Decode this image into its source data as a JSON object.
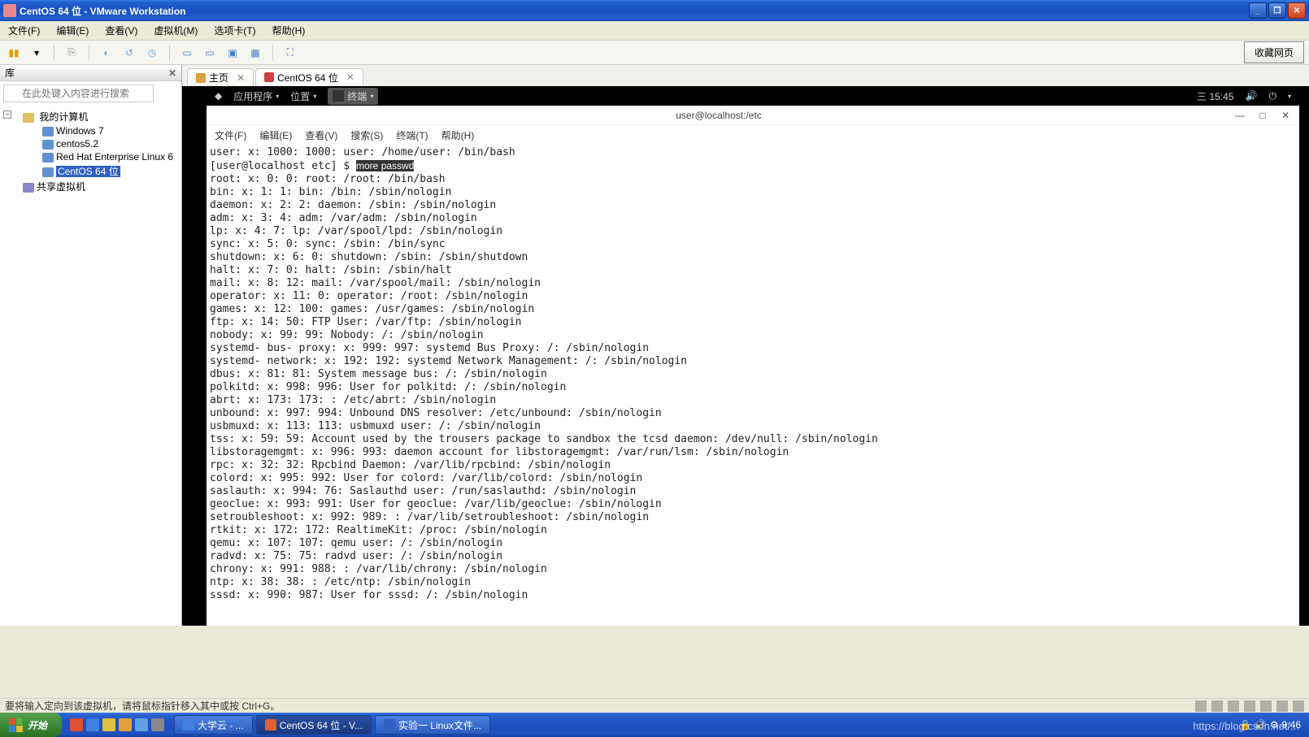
{
  "window": {
    "title": "CentOS 64 位 - VMware Workstation"
  },
  "menubar": {
    "file": "文件(F)",
    "edit": "编辑(E)",
    "view": "查看(V)",
    "vm": "虚拟机(M)",
    "tabs": "选项卡(T)",
    "help": "帮助(H)"
  },
  "toolbar": {
    "bookmark": "收藏网页"
  },
  "library": {
    "title": "库",
    "search_placeholder": "在此处键入内容进行搜索",
    "root": "我的计算机",
    "items": [
      "Windows 7",
      "centos5.2",
      "Red Hat Enterprise Linux 6",
      "CentOS 64 位"
    ],
    "shared": "共享虚拟机"
  },
  "tabs": {
    "home": "主页",
    "vm": "CentOS 64 位"
  },
  "gnome": {
    "apps": "应用程序",
    "places": "位置",
    "terminal": "终端",
    "time": "三 15:45"
  },
  "terminal": {
    "title": "user@localhost:/etc",
    "menu": {
      "file": "文件(F)",
      "edit": "编辑(E)",
      "view": "查看(V)",
      "search": "搜索(S)",
      "term": "终端(T)",
      "help": "帮助(H)"
    },
    "line_pre": "user: x: 1000: 1000: user: /home/user: /bin/bash",
    "prompt": "[user@localhost etc] $ ",
    "command": "more passwd",
    "lines": [
      "root: x: 0: 0: root: /root: /bin/bash",
      "bin: x: 1: 1: bin: /bin: /sbin/nologin",
      "daemon: x: 2: 2: daemon: /sbin: /sbin/nologin",
      "adm: x: 3: 4: adm: /var/adm: /sbin/nologin",
      "lp: x: 4: 7: lp: /var/spool/lpd: /sbin/nologin",
      "sync: x: 5: 0: sync: /sbin: /bin/sync",
      "shutdown: x: 6: 0: shutdown: /sbin: /sbin/shutdown",
      "halt: x: 7: 0: halt: /sbin: /sbin/halt",
      "mail: x: 8: 12: mail: /var/spool/mail: /sbin/nologin",
      "operator: x: 11: 0: operator: /root: /sbin/nologin",
      "games: x: 12: 100: games: /usr/games: /sbin/nologin",
      "ftp: x: 14: 50: FTP User: /var/ftp: /sbin/nologin",
      "nobody: x: 99: 99: Nobody: /: /sbin/nologin",
      "systemd- bus- proxy: x: 999: 997: systemd Bus Proxy: /: /sbin/nologin",
      "systemd- network: x: 192: 192: systemd Network Management: /: /sbin/nologin",
      "dbus: x: 81: 81: System message bus: /: /sbin/nologin",
      "polkitd: x: 998: 996: User for polkitd: /: /sbin/nologin",
      "abrt: x: 173: 173: : /etc/abrt: /sbin/nologin",
      "unbound: x: 997: 994: Unbound DNS resolver: /etc/unbound: /sbin/nologin",
      "usbmuxd: x: 113: 113: usbmuxd user: /: /sbin/nologin",
      "tss: x: 59: 59: Account used by the trousers package to sandbox the tcsd daemon: /dev/null: /sbin/nologin",
      "libstoragemgmt: x: 996: 993: daemon account for libstoragemgmt: /var/run/lsm: /sbin/nologin",
      "rpc: x: 32: 32: Rpcbind Daemon: /var/lib/rpcbind: /sbin/nologin",
      "colord: x: 995: 992: User for colord: /var/lib/colord: /sbin/nologin",
      "saslauth: x: 994: 76: Saslauthd user: /run/saslauthd: /sbin/nologin",
      "geoclue: x: 993: 991: User for geoclue: /var/lib/geoclue: /sbin/nologin",
      "setroubleshoot: x: 992: 989: : /var/lib/setroubleshoot: /sbin/nologin",
      "rtkit: x: 172: 172: RealtimeKit: /proc: /sbin/nologin",
      "qemu: x: 107: 107: qemu user: /: /sbin/nologin",
      "radvd: x: 75: 75: radvd user: /: /sbin/nologin",
      "chrony: x: 991: 988: : /var/lib/chrony: /sbin/nologin",
      "ntp: x: 38: 38: : /etc/ntp: /sbin/nologin",
      "sssd: x: 990: 987: User for sssd: /: /sbin/nologin"
    ]
  },
  "statusbar": {
    "text": "要将输入定向到该虚拟机，请将鼠标指针移入其中或按 Ctrl+G。"
  },
  "taskbar": {
    "start": "开始",
    "items": [
      "大学云 - ...",
      "CentOS 64 位 - V...",
      "实验一 Linux文件..."
    ],
    "time": "9:46"
  },
  "watermark": "https://blog.csdn.net/..."
}
